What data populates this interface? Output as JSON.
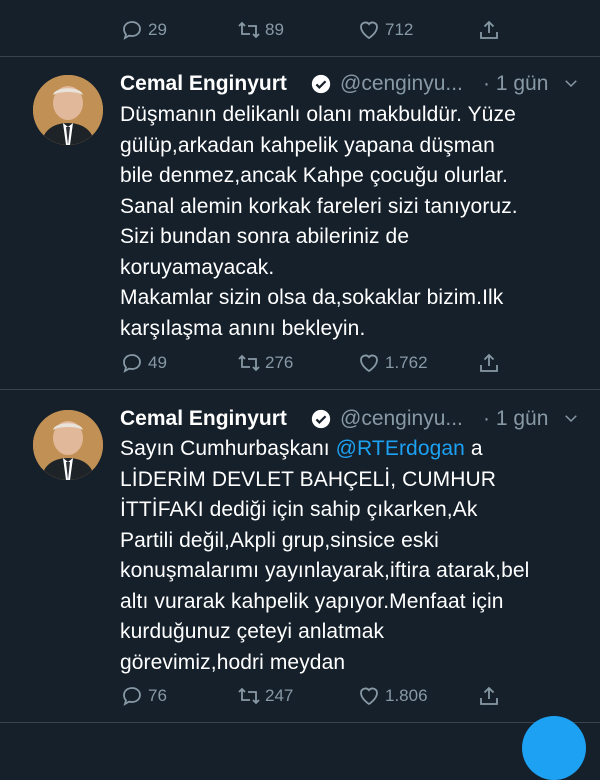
{
  "top_partial": {
    "actions": {
      "reply": "29",
      "retweet": "89",
      "like": "712"
    }
  },
  "tweets": [
    {
      "name": "Cemal Enginyurt",
      "handle": "@cenginyu...",
      "time": "· 1 gün",
      "lines": [
        "Düşmanın delikanlı olanı makbuldür. Yüze",
        "gülüp,arkadan kahpelik yapana düşman",
        "bile denmez,ancak Kahpe çocuğu olurlar.",
        "Sanal alemin korkak fareleri sizi tanıyoruz.",
        "Sizi bundan sonra abileriniz de",
        "koruyamayacak.",
        "Makamlar sizin olsa da,sokaklar bizim.Ilk",
        "karşılaşma anını bekleyin."
      ],
      "actions": {
        "reply": "49",
        "retweet": "276",
        "like": "1.762"
      }
    },
    {
      "name": "Cemal Enginyurt",
      "handle": "@cenginyu...",
      "time": "· 1 gün",
      "line1_pre": "Sayın Cumhurbaşkanı ",
      "line1_mention": "@RTErdogan",
      "line1_post": " a",
      "lines": [
        "LİDERİM DEVLET BAHÇELİ, CUMHUR",
        "İTTİFAKI dediği için sahip çıkarken,Ak",
        "Partili değil,Akpli  grup,sinsice eski",
        "konuşmalarımı yayınlayarak,iftira atarak,bel",
        "altı vurarak kahpelik yapıyor.Menfaat için",
        "kurduğunuz çeteyi anlatmak",
        "görevimiz,hodri meydan"
      ],
      "actions": {
        "reply": "76",
        "retweet": "247",
        "like": "1.806"
      }
    }
  ],
  "colors": {
    "background": "#15202b",
    "muted": "#8899a6",
    "link": "#1da1f2",
    "divider": "#38444d"
  },
  "icons": [
    "reply-icon",
    "retweet-icon",
    "like-icon",
    "share-icon",
    "verified-icon",
    "chevron-down-icon"
  ]
}
